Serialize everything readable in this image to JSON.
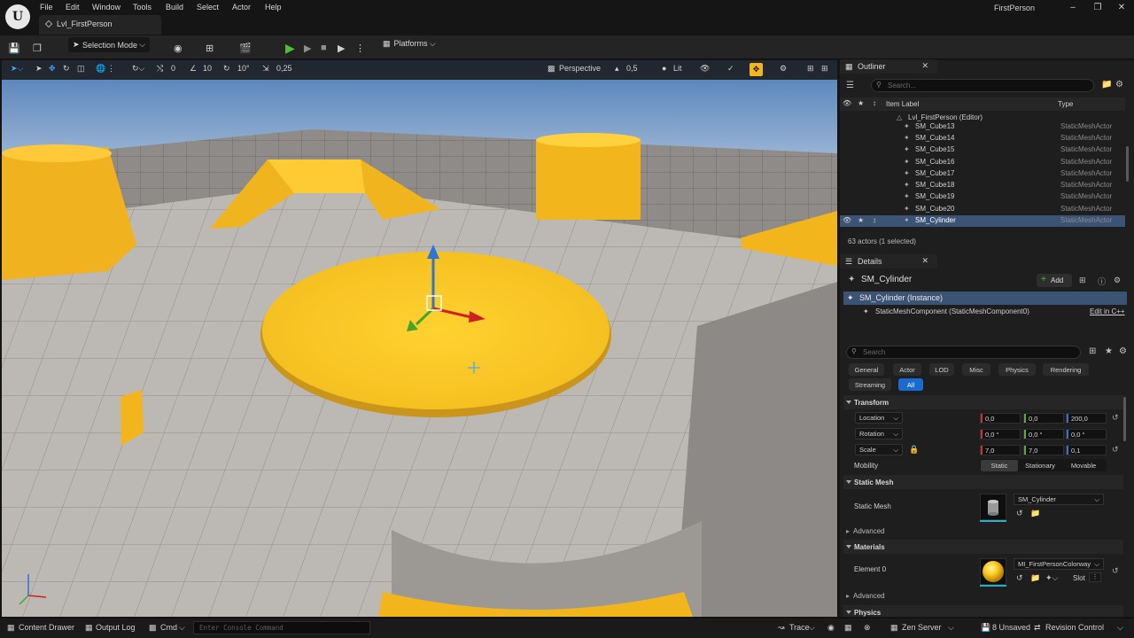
{
  "menubar": {
    "items": [
      "File",
      "Edit",
      "Window",
      "Tools",
      "Build",
      "Select",
      "Actor",
      "Help"
    ],
    "project_name": "FirstPerson",
    "level_tab": "Lvl_FirstPerson"
  },
  "toolbar": {
    "selection_mode": "Selection Mode",
    "platforms": "Platforms"
  },
  "viewport": {
    "translate_snap": "0",
    "rotate_snap": "10",
    "angle_snap": "10°",
    "scale_snap": "0,25",
    "view_mode": "Perspective",
    "fov": "0,5",
    "lighting": "Lit"
  },
  "outliner": {
    "tab": "Outliner",
    "search_placeholder": "Search...",
    "col_label": "Item Label",
    "col_type": "Type",
    "root": "Lvl_FirstPerson (Editor)",
    "rows": [
      {
        "label": "SM_Cube13",
        "type": "StaticMeshActor"
      },
      {
        "label": "SM_Cube14",
        "type": "StaticMeshActor"
      },
      {
        "label": "SM_Cube15",
        "type": "StaticMeshActor"
      },
      {
        "label": "SM_Cube16",
        "type": "StaticMeshActor"
      },
      {
        "label": "SM_Cube17",
        "type": "StaticMeshActor"
      },
      {
        "label": "SM_Cube18",
        "type": "StaticMeshActor"
      },
      {
        "label": "SM_Cube19",
        "type": "StaticMeshActor"
      },
      {
        "label": "SM_Cube20",
        "type": "StaticMeshActor"
      },
      {
        "label": "SM_Cylinder",
        "type": "StaticMeshActor"
      }
    ],
    "footer": "63 actors (1 selected)"
  },
  "details": {
    "tab": "Details",
    "actor_name": "SM_Cylinder",
    "add_label": "Add",
    "instance": "SM_Cylinder (Instance)",
    "component": "StaticMeshComponent (StaticMeshComponent0)",
    "edit_cpp": "Edit in C++",
    "search_placeholder": "Search",
    "categories": [
      "General",
      "Actor",
      "LOD",
      "Misc",
      "Physics",
      "Rendering",
      "Streaming",
      "All"
    ],
    "transform_section": "Transform",
    "location_label": "Location",
    "location": [
      "0,0",
      "0,0",
      "200,0"
    ],
    "rotation_label": "Rotation",
    "rotation": [
      "0,0 °",
      "0,0 °",
      "0,0 °"
    ],
    "scale_label": "Scale",
    "scale": [
      "7,0",
      "7,0",
      "0,1"
    ],
    "mobility_label": "Mobility",
    "mobility": [
      "Static",
      "Stationary",
      "Movable"
    ],
    "static_mesh_section": "Static Mesh",
    "static_mesh_label": "Static Mesh",
    "static_mesh_value": "SM_Cylinder",
    "advanced": "Advanced",
    "materials_section": "Materials",
    "element0_label": "Element 0",
    "material_value": "MI_FirstPersonColorway",
    "slot_label": "Slot",
    "physics_section": "Physics"
  },
  "statusbar": {
    "content_drawer": "Content Drawer",
    "output_log": "Output Log",
    "cmd": "Cmd",
    "console_placeholder": "Enter Console Command",
    "trace": "Trace",
    "zen_server": "Zen Server",
    "unsaved": "8 Unsaved",
    "revision_control": "Revision Control"
  },
  "colors": {
    "accent": "#f2b51c",
    "selection": "#3c5474",
    "play": "#4fbf3a",
    "all_tab": "#1a6bcf"
  }
}
